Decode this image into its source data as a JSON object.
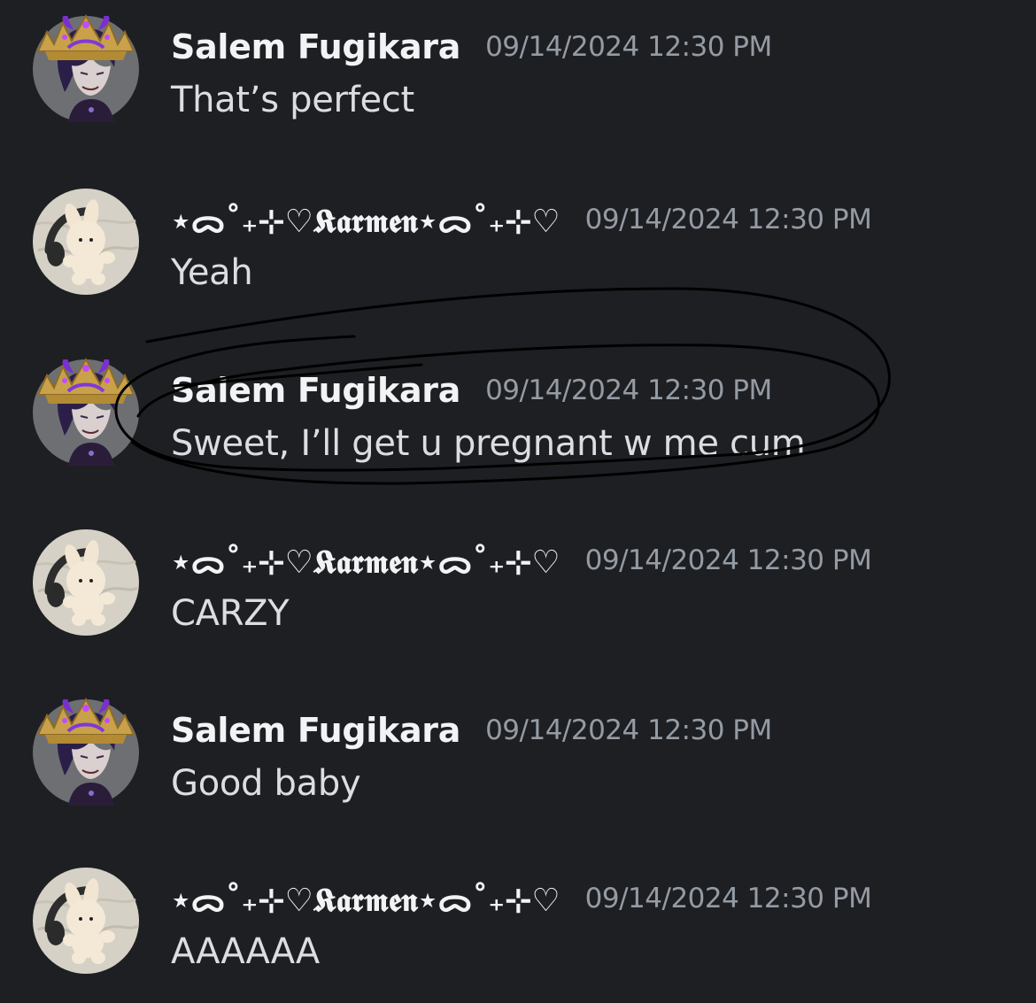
{
  "colors": {
    "background": "#1e1f22",
    "username": "#f2f3f5",
    "timestamp": "#949ba4",
    "message_text": "#dbdee1",
    "annotation_stroke": "#000000"
  },
  "messages": [
    {
      "author": "Salem Fugikara",
      "author_style": "plain",
      "avatar_icon": "crowned-character-avatar-icon",
      "timestamp": "09/14/2024 12:30 PM",
      "text": "That’s perfect"
    },
    {
      "author": "⋆ᯅ˚₊⊹♡𝕶𝖆𝖗𝖒𝖊𝖓⋆ᯅ˚₊⊹♡",
      "author_style": "fancy",
      "avatar_icon": "plush-bunny-avatar-icon",
      "timestamp": "09/14/2024 12:30 PM",
      "text": "Yeah"
    },
    {
      "author": "Salem Fugikara",
      "author_style": "plain",
      "avatar_icon": "crowned-character-avatar-icon",
      "timestamp": "09/14/2024 12:30 PM",
      "text": "Sweet, I’ll get u pregnant w me cum"
    },
    {
      "author": "⋆ᯅ˚₊⊹♡𝕶𝖆𝖗𝖒𝖊𝖓⋆ᯅ˚₊⊹♡",
      "author_style": "fancy",
      "avatar_icon": "plush-bunny-avatar-icon",
      "timestamp": "09/14/2024 12:30 PM",
      "text": "CARZY"
    },
    {
      "author": "Salem Fugikara",
      "author_style": "plain",
      "avatar_icon": "crowned-character-avatar-icon",
      "timestamp": "09/14/2024 12:30 PM",
      "text": "Good baby"
    },
    {
      "author": "⋆ᯅ˚₊⊹♡𝕶𝖆𝖗𝖒𝖊𝖓⋆ᯅ˚₊⊹♡",
      "author_style": "fancy",
      "avatar_icon": "plush-bunny-avatar-icon",
      "timestamp": "09/14/2024 12:30 PM",
      "text": "AAAAAA"
    }
  ],
  "annotation": {
    "type": "hand-drawn-circle",
    "target_message_index": 2
  }
}
